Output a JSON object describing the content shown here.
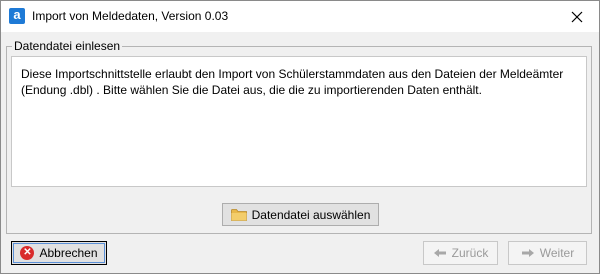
{
  "window": {
    "app_icon_letter": "a",
    "title": "Import von Meldedaten, Version 0.03"
  },
  "group": {
    "legend": "Datendatei einlesen",
    "description": "Diese Importschnittstelle erlaubt den Import von Schülerstammdaten aus den Dateien der Meldeämter (Endung .dbl) . Bitte wählen Sie die Datei aus, die die zu importierenden Daten enthält."
  },
  "buttons": {
    "select_file": "Datendatei auswählen",
    "cancel": "Abbrechen",
    "back": "Zurück",
    "next": "Weiter"
  },
  "colors": {
    "accent": "#1e7ad6",
    "cancel_icon": "#d92b2b",
    "folder_icon": "#e8b84a",
    "disabled_text": "#9a9a9a"
  }
}
